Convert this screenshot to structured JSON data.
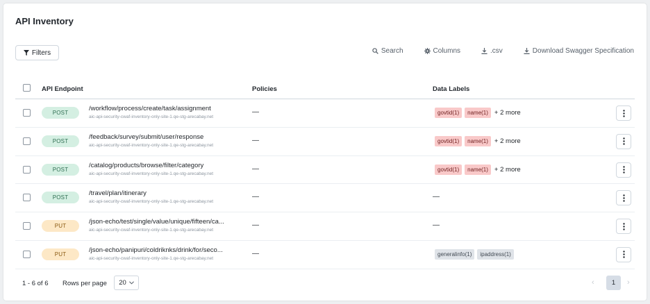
{
  "title": "API Inventory",
  "toolbar": {
    "filters": "Filters",
    "search": "Search",
    "columns": "Columns",
    "csv": ".csv",
    "swagger": "Download Swagger Specification"
  },
  "table": {
    "headers": {
      "endpoint": "API Endpoint",
      "policies": "Policies",
      "labels": "Data Labels"
    },
    "rows": [
      {
        "method": "POST",
        "path": "/workflow/process/create/task/assignment",
        "host": "aic-api-security-cwaf-inventory-only-site-1.qe-stg-arecabay.net",
        "policies": "—",
        "labels": [
          "govtid(1)",
          "name(1)"
        ],
        "more": "+ 2 more",
        "label_style": "red"
      },
      {
        "method": "POST",
        "path": "/feedback/survey/submit/user/response",
        "host": "aic-api-security-cwaf-inventory-only-site-1.qe-stg-arecabay.net",
        "policies": "—",
        "labels": [
          "govtid(1)",
          "name(1)"
        ],
        "more": "+ 2 more",
        "label_style": "red"
      },
      {
        "method": "POST",
        "path": "/catalog/products/browse/filter/category",
        "host": "aic-api-security-cwaf-inventory-only-site-1.qe-stg-arecabay.net",
        "policies": "—",
        "labels": [
          "govtid(1)",
          "name(1)"
        ],
        "more": "+ 2 more",
        "label_style": "red"
      },
      {
        "method": "POST",
        "path": "/travel/plan/itinerary",
        "host": "aic-api-security-cwaf-inventory-only-site-1.qe-stg-arecabay.net",
        "policies": "—",
        "labels_empty": "—"
      },
      {
        "method": "PUT",
        "path": "/json-echo/test/single/value/unique/fifteen/ca...",
        "host": "aic-api-security-cwaf-inventory-only-site-1.qe-stg-arecabay.net",
        "policies": "—",
        "labels_empty": "—"
      },
      {
        "method": "PUT",
        "path": "/json-echo/panipuri/coldriknks/drink/for/seco...",
        "host": "aic-api-security-cwaf-inventory-only-site-1.qe-stg-arecabay.net",
        "policies": "—",
        "labels": [
          "generalinfo(1)",
          "ipaddress(1)"
        ],
        "label_style": "gray"
      }
    ]
  },
  "footer": {
    "range": "1 - 6 of 6",
    "rows_per_page_label": "Rows per page",
    "rows_per_page_value": "20",
    "page": "1",
    "prev": "‹",
    "next": "›"
  }
}
